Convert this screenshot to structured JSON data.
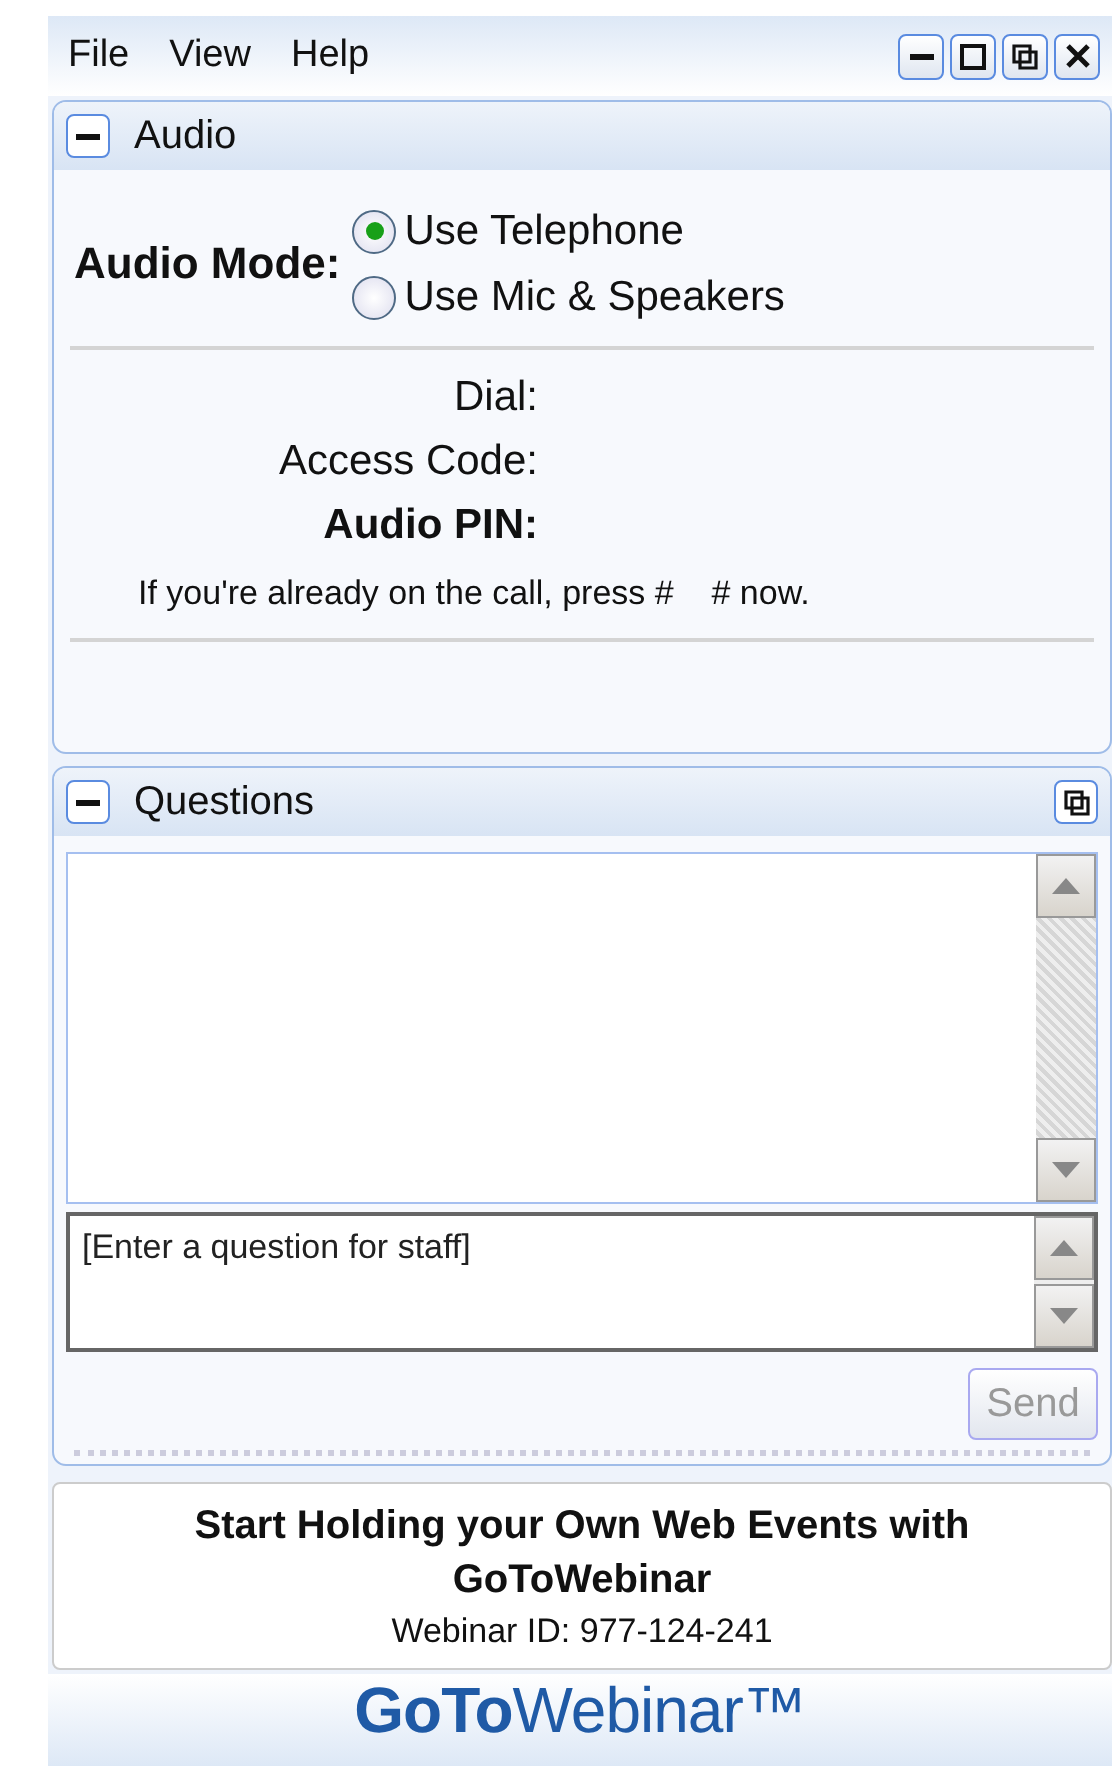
{
  "menu": [
    "File",
    "View",
    "Help"
  ],
  "audio": {
    "title": "Audio",
    "mode_label": "Audio Mode:",
    "options": [
      {
        "label": "Use Telephone",
        "selected": true
      },
      {
        "label": "Use Mic & Speakers",
        "selected": false
      }
    ],
    "fields": [
      {
        "label": "Dial:",
        "bold": false
      },
      {
        "label": "Access Code:",
        "bold": false
      },
      {
        "label": "Audio PIN:",
        "bold": true
      }
    ],
    "message": "If you're already on the call, press #    # now."
  },
  "questions": {
    "title": "Questions",
    "placeholder": "[Enter a question for staff]",
    "send": "Send",
    "send_disabled": true
  },
  "promo": {
    "headline": "Start Holding your Own Web Events with GoToWebinar",
    "webinar_id": "Webinar ID: 977-124-241"
  },
  "logo": "**GoTo**Webinar™"
}
